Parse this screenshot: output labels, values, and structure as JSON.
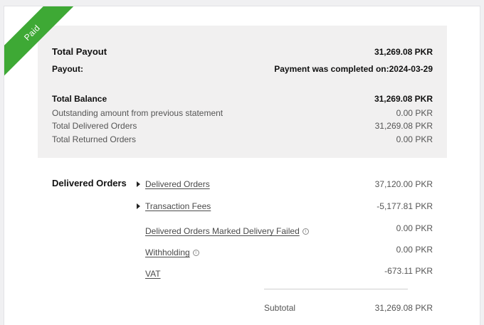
{
  "status_ribbon": "Paid",
  "summary": {
    "total_payout_label": "Total Payout",
    "total_payout_value": "31,269.08 PKR",
    "payout_label": "Payout:",
    "payout_value": "Payment was completed on:2024-03-29",
    "total_balance_label": "Total Balance",
    "total_balance_value": "31,269.08 PKR",
    "lines": [
      {
        "label": "Outstanding amount from previous statement",
        "value": "0.00 PKR"
      },
      {
        "label": "Total Delivered Orders",
        "value": "31,269.08 PKR"
      },
      {
        "label": "Total Returned Orders",
        "value": "0.00 PKR"
      }
    ]
  },
  "delivered": {
    "title": "Delivered Orders",
    "items": [
      {
        "label": "Delivered Orders",
        "value": "37,120.00 PKR"
      },
      {
        "label": "Transaction Fees",
        "value": "-5,177.81 PKR"
      },
      {
        "label": "Delivered Orders Marked Delivery Failed",
        "value": "0.00 PKR"
      },
      {
        "label": "Withholding",
        "value": "0.00 PKR"
      },
      {
        "label": "VAT",
        "value": "-673.11 PKR"
      }
    ],
    "subtotal_label": "Subtotal",
    "subtotal_value": "31,269.08 PKR"
  },
  "colors": {
    "ribbon": "#3ea935",
    "summary_bg": "#f1f0f0"
  },
  "icons": {
    "expand": "caret-right-icon",
    "info": "info-circle-icon"
  }
}
